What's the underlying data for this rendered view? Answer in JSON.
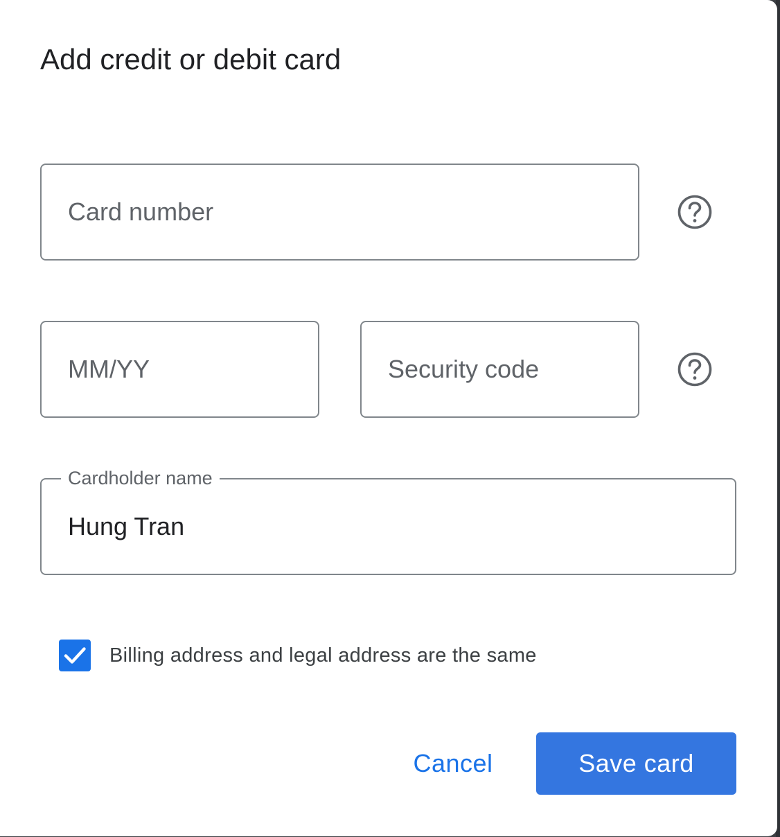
{
  "dialog": {
    "title": "Add credit or debit card"
  },
  "form": {
    "card_number": {
      "placeholder": "Card number",
      "value": ""
    },
    "expiry": {
      "placeholder": "MM/YY",
      "value": ""
    },
    "security_code": {
      "placeholder": "Security code",
      "value": ""
    },
    "cardholder_name": {
      "label": "Cardholder name",
      "value": "Hung Tran"
    },
    "billing_same": {
      "checked": true,
      "label": "Billing address and legal address are the same"
    }
  },
  "icons": {
    "card_number_help": "help-circle-icon",
    "security_code_help": "help-circle-icon",
    "checkbox_check": "check-icon"
  },
  "actions": {
    "cancel_label": "Cancel",
    "save_label": "Save card"
  },
  "colors": {
    "accent": "#1a73e8",
    "save_button": "#3476e0",
    "border": "#80868b",
    "text": "#202124",
    "placeholder": "#5f6368"
  }
}
